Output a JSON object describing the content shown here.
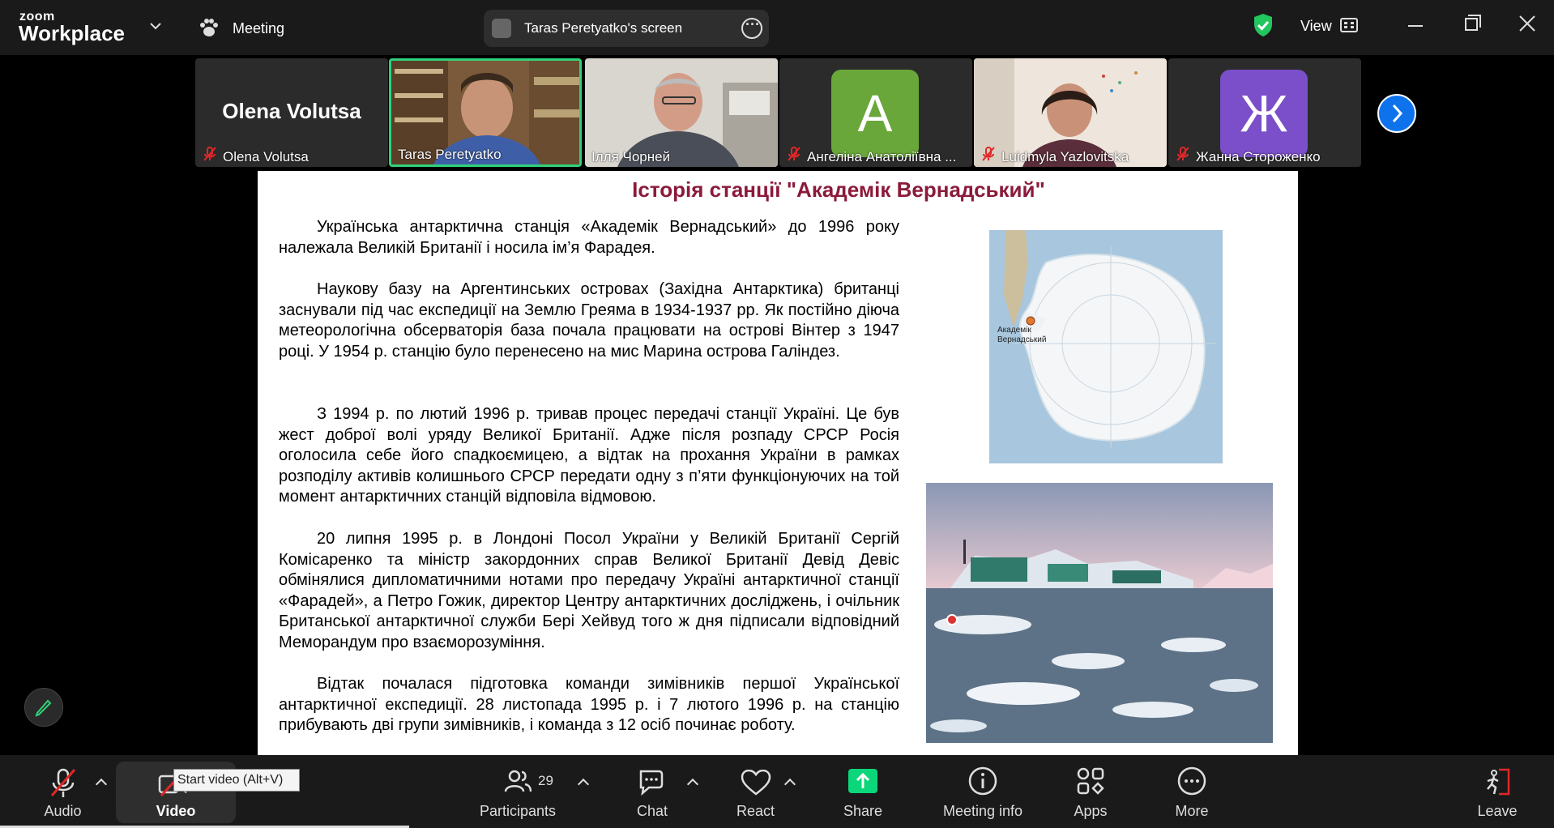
{
  "app": {
    "logo_small": "zoom",
    "logo_big": "Workplace"
  },
  "topbar": {
    "meeting_label": "Meeting",
    "share_label": "Taras Peretyatko's screen",
    "view_label": "View"
  },
  "participants_strip": [
    {
      "name": "Olena Volutsa",
      "muted": true,
      "display": "name",
      "big_name": "Olena Volutsa"
    },
    {
      "name": "Taras Peretyatko",
      "muted": false,
      "display": "video",
      "active_speaker": true
    },
    {
      "name": "Ілля Чорней",
      "muted": false,
      "display": "video"
    },
    {
      "name": "Ангеліна Анатоліївна ...",
      "muted": true,
      "display": "avatar",
      "avatar_letter": "А",
      "avatar_color": "#6aa73a"
    },
    {
      "name": "Luidmyla Yazlovitska",
      "muted": true,
      "display": "video"
    },
    {
      "name": "Жанна Стороженко",
      "muted": true,
      "display": "avatar",
      "avatar_letter": "Ж",
      "avatar_color": "#7b4fc9"
    }
  ],
  "slide": {
    "title": "Історія станції \"Академік Вернадський\"",
    "paragraphs": [
      "Українська антарктична станція «Академік Вернадський» до 1996 року належала Великій Британії і носила ім’я Фарадея.",
      "Наукову базу на Аргентинських островах (Західна Антарктика) британці заснували під час експедиції на Землю Греяма в 1934-1937 рр. Як постійно діюча метеорологічна обсерваторія база почала працювати на острові Вінтер з 1947 році. У 1954 р. станцію було перенесено на мис Марина острова Галіндез.",
      "З 1994 р. по лютий 1996 р. тривав процес передачі станції Україні. Це був жест доброї волі уряду Великої Британії. Адже після розпаду СРСР Росія оголосила себе його спадкоємицею, а відтак на прохання України в рамках розподілу активів колишнього СРСР передати одну з п’яти функціонуючих на той момент антарктичних станцій відповіла відмовою.",
      "20 липня 1995 р. в Лондоні Посол України у Великій Британії Сергій Комісаренко та міністр закордонних справ Великої Британії Девід Девіс обмінялися дипломатичними нотами про передачу Україні антарктичної станції «Фарадей», а Петро Гожик, директор Центру антарктичних досліджень, і очільник Британської антарктичної служби Бері Хейвуд того ж дня підписали відповідний Меморандум про взаєморозуміння.",
      "Відтак почалася підготовка команди зимівників першої Української антарктичної експедиції. 28 листопада 1995 р. і 7 лютого 1996 р. на станцію прибувають дві групи зимівників, і команда з 12 осіб починає роботу."
    ],
    "map_label_1": "Академік",
    "map_label_2": "Вернадський"
  },
  "toolbar": {
    "audio": "Audio",
    "video": "Video",
    "video_tooltip": "Start video (Alt+V)",
    "participants": "Participants",
    "participants_count": "29",
    "chat": "Chat",
    "react": "React",
    "share": "Share",
    "meeting_info": "Meeting info",
    "apps": "Apps",
    "more": "More",
    "leave": "Leave"
  },
  "colors": {
    "accent": "#0e72ed",
    "share_green": "#0bd67a",
    "leave_red": "#e02828",
    "title_red": "#8b1a3a"
  }
}
